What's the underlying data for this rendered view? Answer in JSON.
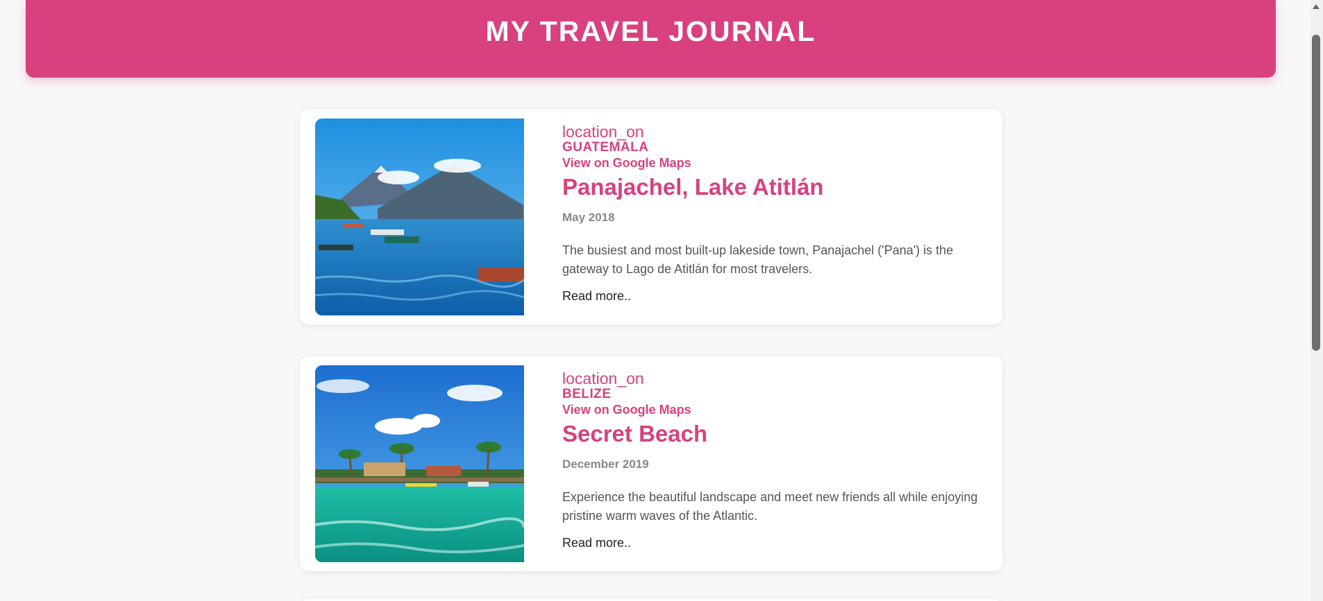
{
  "header": {
    "title": "MY TRAVEL JOURNAL"
  },
  "entries": [
    {
      "location_icon_text": "location_on",
      "country": "GUATEMALA",
      "maps_link": "View on Google Maps",
      "title": "Panajachel, Lake Atitlán",
      "date": "May 2018",
      "description": "The busiest and most built-up lakeside town, Panajachel ('Pana') is the gateway to Lago de Atitlán for most travelers.",
      "read_more": "Read more..",
      "image": "lake-with-volcanoes-photo"
    },
    {
      "location_icon_text": "location_on",
      "country": "BELIZE",
      "maps_link": "View on Google Maps",
      "title": "Secret Beach",
      "date": "December 2019",
      "description": "Experience the beautiful landscape and meet new friends all while enjoying pristine warm waves of the Atlantic.",
      "read_more": "Read more..",
      "image": "tropical-beach-dock-photo"
    }
  ],
  "colors": {
    "accent": "#d8417e",
    "page_background": "#f8f8f8",
    "card_background": "#ffffff",
    "date_text": "#888888",
    "description_text": "#555555"
  }
}
